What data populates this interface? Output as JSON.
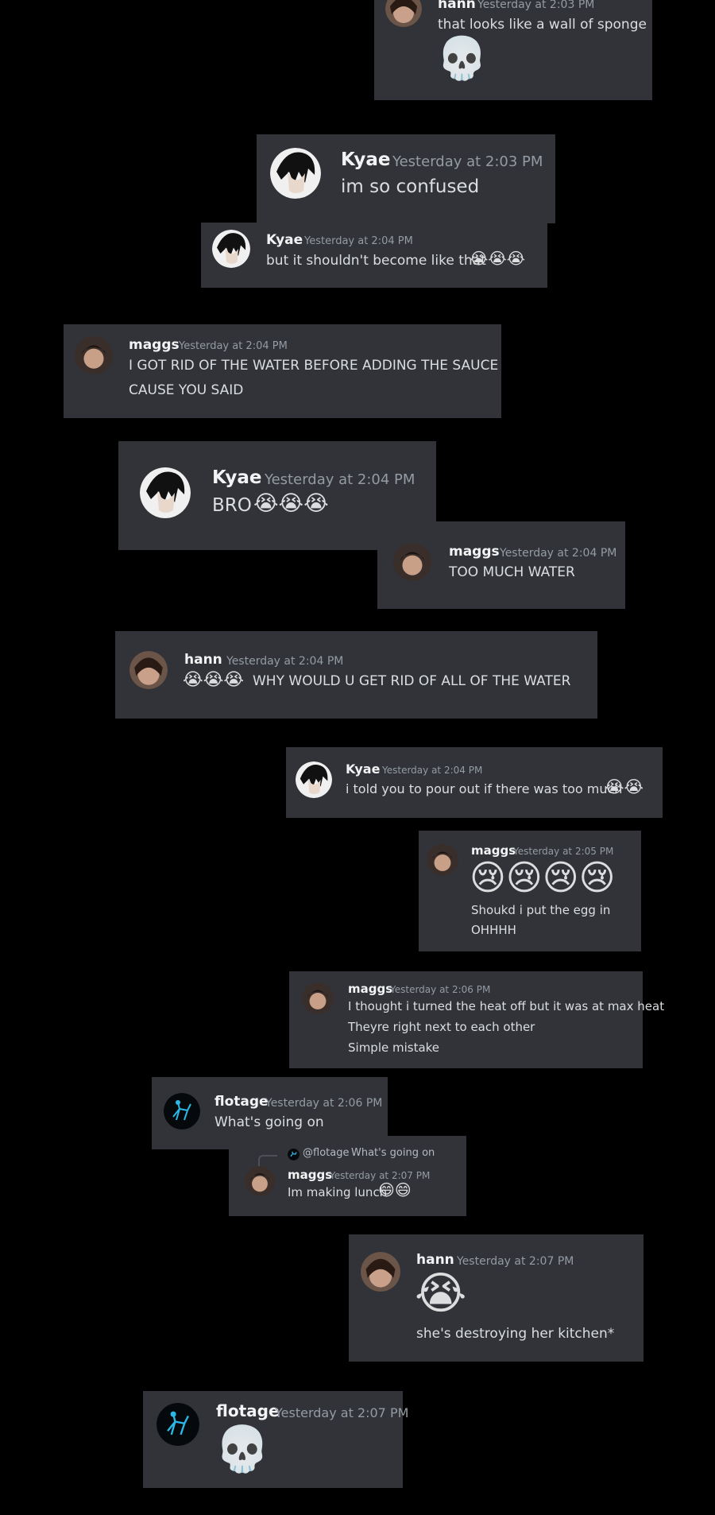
{
  "messages": [
    {
      "id": "m1",
      "author": "hann",
      "time": "Yesterday at 2:03 PM",
      "lines": [
        "that looks like a wall of sponge"
      ],
      "emoji": "💀"
    },
    {
      "id": "m2",
      "author": "Kyae",
      "time": "Yesterday at 2:03 PM",
      "lines": [
        "im so confused"
      ]
    },
    {
      "id": "m3",
      "author": "Kyae",
      "time": "Yesterday at 2:04 PM",
      "lines": [
        "but it shouldn't become like that"
      ],
      "emoji": "😭😭😭"
    },
    {
      "id": "m4",
      "author": "maggs",
      "time": "Yesterday at 2:04 PM",
      "lines": [
        "I GOT RID OF THE WATER BEFORE ADDING THE SAUCE",
        "CAUSE YOU SAID"
      ]
    },
    {
      "id": "m5",
      "author": "Kyae",
      "time": "Yesterday at 2:04 PM",
      "lines": [
        "BRO"
      ],
      "emoji": "😭😭😭"
    },
    {
      "id": "m6",
      "author": "maggs",
      "time": "Yesterday at 2:04 PM",
      "lines": [
        "TOO MUCH WATER"
      ]
    },
    {
      "id": "m7",
      "author": "hann",
      "time": "Yesterday at 2:04 PM",
      "lines": [
        "WHY WOULD U GET RID OF ALL OF THE WATER"
      ],
      "emoji": "😭😭😭"
    },
    {
      "id": "m8",
      "author": "Kyae",
      "time": "Yesterday at 2:04 PM",
      "lines": [
        "i told you to pour out if there was too much"
      ],
      "emoji": "😭😭"
    },
    {
      "id": "m9",
      "author": "maggs",
      "time": "Yesterday at 2:05 PM",
      "lines": [
        "Shoukd i put the egg in",
        "OHHHH"
      ],
      "emoji": "😢😢😢😢"
    },
    {
      "id": "m10",
      "author": "maggs",
      "time": "Yesterday at 2:06 PM",
      "lines": [
        "I thought i turned the heat off but it was at max heat",
        "Theyre right next to each other",
        "Simple mistake"
      ]
    },
    {
      "id": "m11",
      "author": "flotage",
      "time": "Yesterday at 2:06 PM",
      "lines": [
        "What's going on"
      ]
    },
    {
      "id": "m12",
      "author": "maggs",
      "time": "Yesterday at 2:07 PM",
      "lines": [
        "Im making lunch"
      ],
      "emoji": "😄😄",
      "reply": {
        "mention": "@flotage",
        "text": "What's going on"
      }
    },
    {
      "id": "m13",
      "author": "hann",
      "time": "Yesterday at 2:07 PM",
      "lines": [
        "she's destroying her kitchen*"
      ],
      "emoji": "😭"
    },
    {
      "id": "m14",
      "author": "flotage",
      "time": "Yesterday at 2:07 PM",
      "lines": [],
      "emoji": "💀"
    }
  ],
  "colors": {
    "background": "#000000",
    "card": "#313338",
    "username": "#f2f3f5",
    "timestamp": "#949ba4",
    "text": "#dbdee1"
  }
}
